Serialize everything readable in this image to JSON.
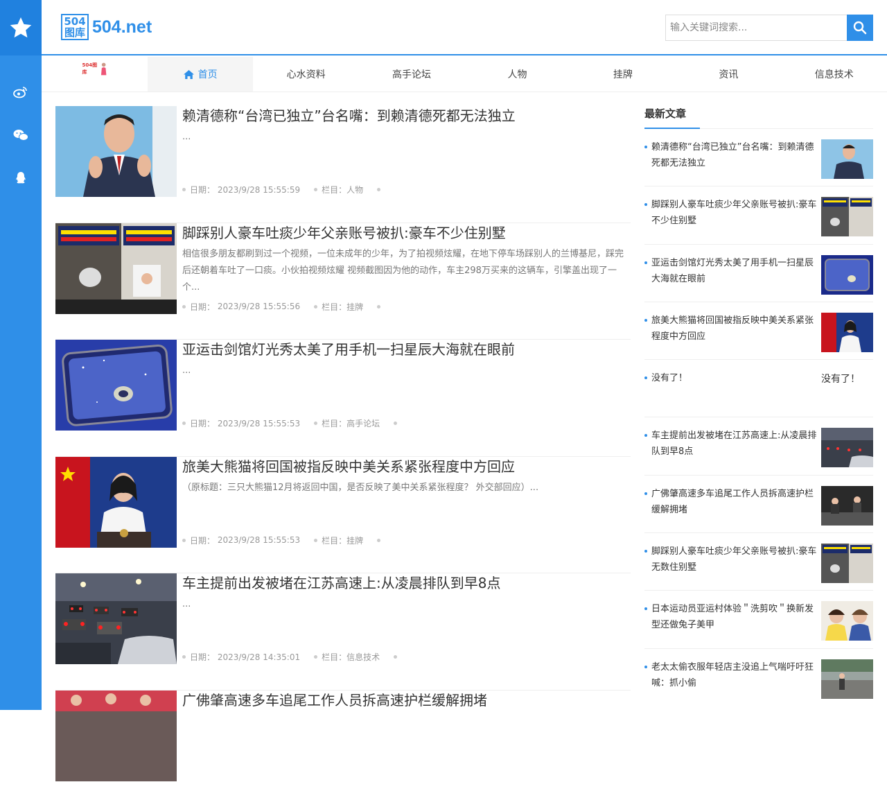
{
  "site": {
    "logo_box": "504\n图库",
    "logo_text": "504.net",
    "nav_logo": "504图库"
  },
  "search": {
    "placeholder": "输入关键词搜索..."
  },
  "nav": [
    "首页",
    "心水资料",
    "高手论坛",
    "人物",
    "挂牌",
    "资讯",
    "信息技术"
  ],
  "articles": [
    {
      "title": "赖清德称“台湾已独立”台名嘴：到赖清德死都无法独立",
      "excerpt": "...",
      "date_label": "日期：",
      "date": "2023/9/28 15:55:59",
      "cat_label": "栏目：",
      "cat": "人物"
    },
    {
      "title": "脚踩别人豪车吐痰少年父亲账号被扒:豪车不少住别墅",
      "excerpt": "相信很多朋友都刷到过一个视频，一位未成年的少年，为了拍视频炫耀，在地下停车场踩别人的兰博基尼，踩完后还朝着车吐了一口痰。小伙拍视频炫耀 视频截图因为他的动作，车主298万买来的这辆车，引擎盖出现了一个...",
      "date_label": "日期：",
      "date": "2023/9/28 15:55:56",
      "cat_label": "栏目：",
      "cat": "挂牌"
    },
    {
      "title": "亚运击剑馆灯光秀太美了用手机一扫星辰大海就在眼前",
      "excerpt": "...",
      "date_label": "日期：",
      "date": "2023/9/28 15:55:53",
      "cat_label": "栏目：",
      "cat": "高手论坛"
    },
    {
      "title": "旅美大熊猫将回国被指反映中美关系紧张程度中方回应",
      "excerpt": "（原标题：三只大熊猫12月将返回中国，是否反映了美中关系紧张程度？ 外交部回应）...",
      "date_label": "日期：",
      "date": "2023/9/28 15:55:53",
      "cat_label": "栏目：",
      "cat": "挂牌"
    },
    {
      "title": "车主提前出发被堵在江苏高速上:从凌晨排队到早8点",
      "excerpt": "...",
      "date_label": "日期：",
      "date": "2023/9/28 14:35:01",
      "cat_label": "栏目：",
      "cat": "信息技术"
    },
    {
      "title": "广佛肇高速多车追尾工作人员拆高速护栏缓解拥堵",
      "excerpt": "",
      "date_label": "",
      "date": "",
      "cat_label": "",
      "cat": ""
    }
  ],
  "sidebar": {
    "title": "最新文章",
    "none_label": "没有了！",
    "items": [
      "赖清德称“台湾已独立”台名嘴：到赖清德死都无法独立",
      "脚踩别人豪车吐痰少年父亲账号被扒:豪车不少住别墅",
      "亚运击剑馆灯光秀太美了用手机一扫星辰大海就在眼前",
      "旅美大熊猫将回国被指反映中美关系紧张程度中方回应",
      "没有了！",
      "车主提前出发被堵在江苏高速上:从凌晨排队到早8点",
      "广佛肇高速多车追尾工作人员拆高速护栏缓解拥堵",
      "脚踩别人豪车吐痰少年父亲账号被扒:豪车无数住别墅",
      "日本运动员亚运村体验＂洗剪吹＂换新发型还做兔子美甲",
      "老太太偷衣服年轻店主没追上气喘吁吁狂喊：抓小偷"
    ]
  },
  "colors": {
    "accent": "#2f8fe8"
  }
}
